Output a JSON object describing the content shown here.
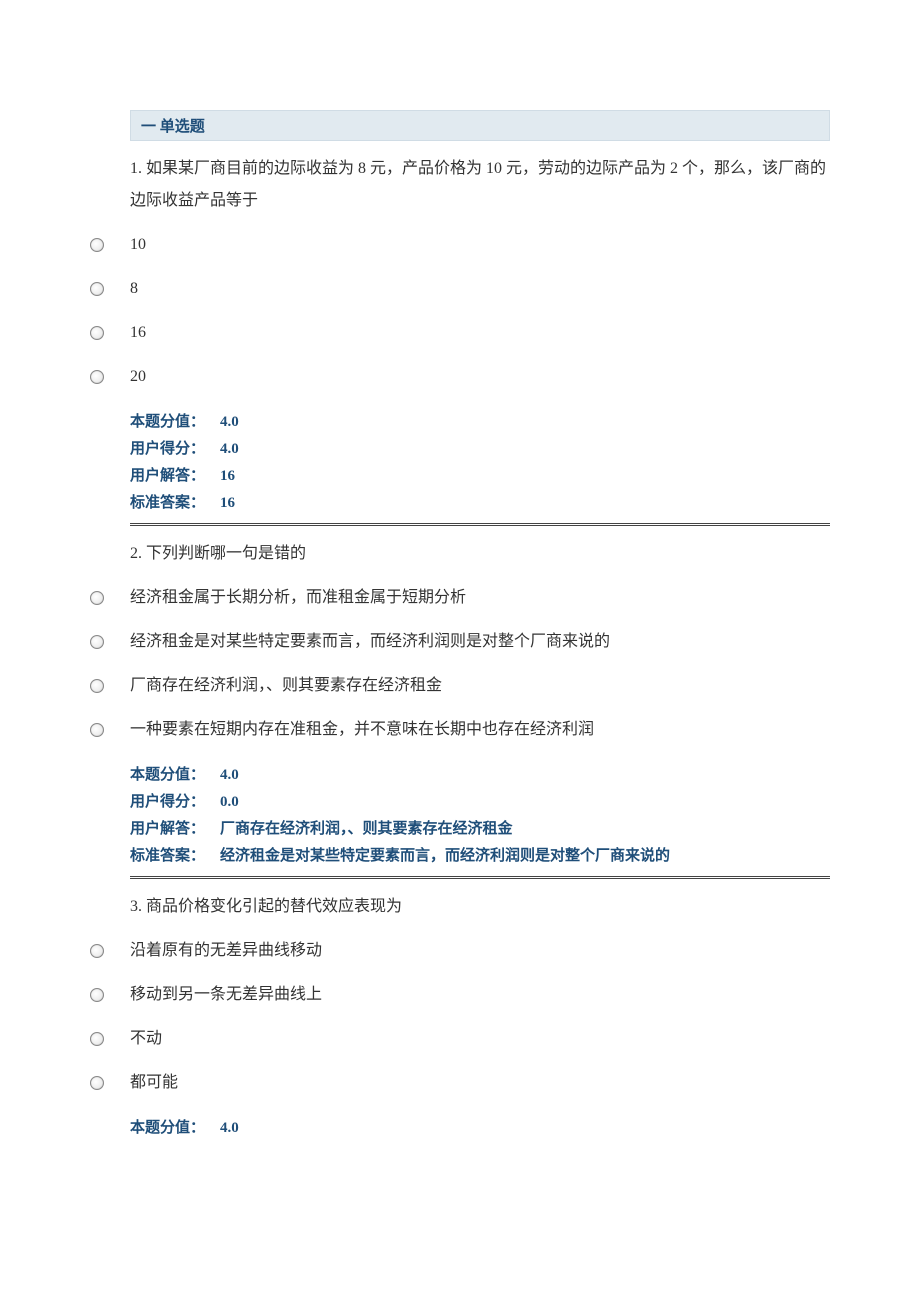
{
  "section_title": "一  单选题",
  "questions": [
    {
      "number": "1.",
      "text": "如果某厂商目前的边际收益为 8 元，产品价格为 10 元，劳动的边际产品为 2 个，那么，该厂商的边际收益产品等于",
      "options": [
        "10",
        "8",
        "16",
        "20"
      ],
      "score_label": "本题分值：",
      "score_value": "4.0",
      "user_score_label": "用户得分：",
      "user_score_value": "4.0",
      "user_answer_label": "用户解答：",
      "user_answer_value": "16",
      "correct_label": "标准答案：",
      "correct_value": "16"
    },
    {
      "number": "2.",
      "text": "下列判断哪一句是错的",
      "options": [
        "经济租金属于长期分析，而准租金属于短期分析",
        "经济租金是对某些特定要素而言，而经济利润则是对整个厂商来说的",
        "厂商存在经济利润，、则其要素存在经济租金",
        "一种要素在短期内存在准租金，并不意味在长期中也存在经济利润"
      ],
      "score_label": "本题分值：",
      "score_value": "4.0",
      "user_score_label": "用户得分：",
      "user_score_value": "0.0",
      "user_answer_label": "用户解答：",
      "user_answer_value": "厂商存在经济利润，、则其要素存在经济租金",
      "correct_label": "标准答案：",
      "correct_value": "经济租金是对某些特定要素而言，而经济利润则是对整个厂商来说的"
    },
    {
      "number": "3.",
      "text": "商品价格变化引起的替代效应表现为",
      "options": [
        "沿着原有的无差异曲线移动",
        "移动到另一条无差异曲线上",
        "不动",
        "都可能"
      ],
      "score_label": "本题分值：",
      "score_value": "4.0"
    }
  ]
}
